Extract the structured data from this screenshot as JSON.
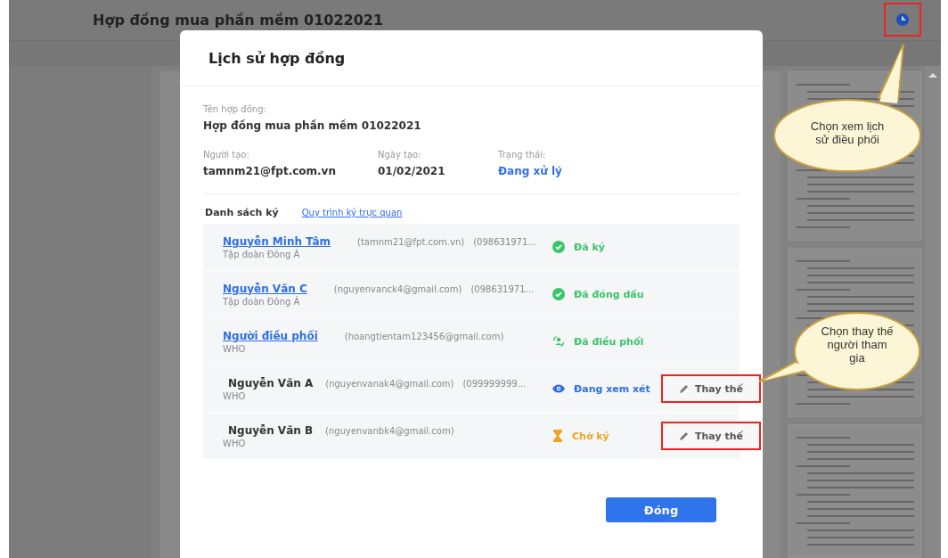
{
  "header": {
    "title": "Hợp đồng mua phần mềm 01022021",
    "history_highlighted": true
  },
  "dialog": {
    "title": "Lịch sử hợp đồng",
    "contract_name": {
      "label": "Tên hợp đồng:",
      "value": "Hợp đồng mua phần mềm 01022021"
    },
    "info": [
      {
        "label": "Người tạo:",
        "value": "tamnm21@fpt.com.vn",
        "kind": "plain"
      },
      {
        "label": "Ngày tạo:",
        "value": "01/02/2021",
        "kind": "plain"
      },
      {
        "label": "Trạng thái:",
        "value": "Đang xử lý",
        "kind": "status"
      }
    ],
    "signers_heading": "Danh sách ký",
    "flow_link": "Quy trình ký trực quan",
    "signers": [
      {
        "name": "Nguyễn Minh Tâm",
        "linked": true,
        "org": "Tập đoàn Đông Á",
        "email": "(tamnm21@fpt.com.vn)",
        "phone": "(098631971...",
        "status": {
          "text": "Đã ký",
          "kind": "check",
          "color": "#3cc46a"
        }
      },
      {
        "name": "Nguyễn Văn C",
        "linked": true,
        "org": "Tập đoàn Đông Á",
        "email": "(nguyenvanck4@gmail.com)",
        "phone": "(098631971...",
        "status": {
          "text": "Đã đóng dấu",
          "kind": "check",
          "color": "#3cc46a"
        }
      },
      {
        "name": "Người điều phối",
        "linked": true,
        "org": "WHO",
        "email": "(hoangtientam123456@gmail.com)",
        "status": {
          "text": "Đã điều phối",
          "kind": "coordinate",
          "color": "#3cc46a"
        }
      },
      {
        "name": "Nguyễn Văn A",
        "linked": false,
        "org": "WHO",
        "email": "(nguyenvanak4@gmail.com)",
        "phone": "(099999999...",
        "status": {
          "text": "Đang xem xét",
          "kind": "eye",
          "color": "#2f6fe6"
        },
        "replace": {
          "label": "Thay thế",
          "highlighted": true
        }
      },
      {
        "name": "Nguyễn Văn B",
        "linked": false,
        "org": "WHO",
        "email": "(nguyenvanbk4@gmail.com)",
        "status": {
          "text": "Chờ ký",
          "kind": "hourglass",
          "color": "#f2a21b"
        },
        "replace": {
          "label": "Thay thế",
          "highlighted": true
        }
      }
    ],
    "close_button": "Đóng"
  },
  "callouts": [
    {
      "text": "Chọn xem lịch sử điều phối",
      "kind": "history"
    },
    {
      "text": "Chọn thay thế người tham gia",
      "kind": "replace"
    }
  ]
}
